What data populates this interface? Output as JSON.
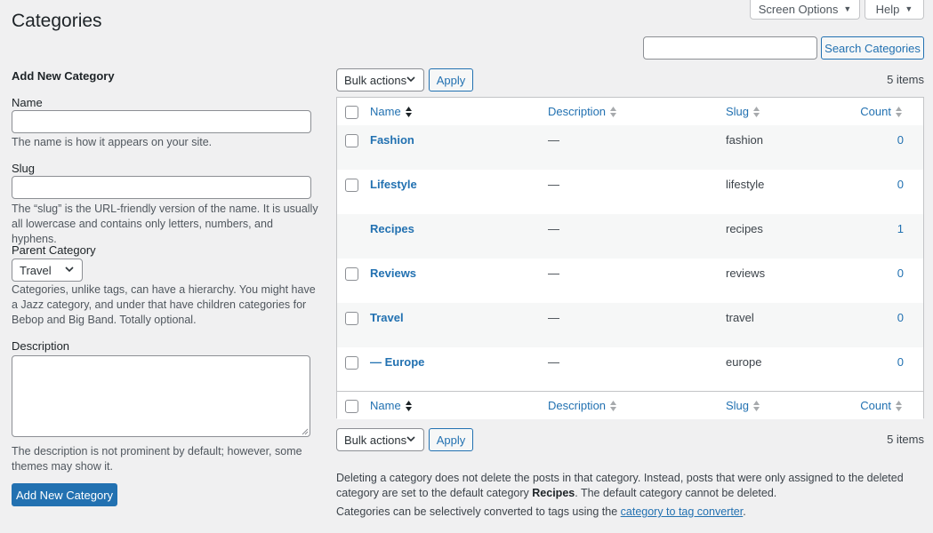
{
  "header": {
    "title": "Categories",
    "screen_options": "Screen Options",
    "help": "Help"
  },
  "search": {
    "value": "",
    "button": "Search Categories"
  },
  "form": {
    "title": "Add New Category",
    "name_label": "Name",
    "name_value": "",
    "name_help": "The name is how it appears on your site.",
    "slug_label": "Slug",
    "slug_value": "",
    "slug_help": "The “slug” is the URL-friendly version of the name. It is usually all lowercase and contains only letters, numbers, and hyphens.",
    "parent_label": "Parent Category",
    "parent_value": "Travel",
    "parent_help": "Categories, unlike tags, can have a hierarchy. You might have a Jazz category, and under that have children categories for Bebop and Big Band. Totally optional.",
    "description_label": "Description",
    "description_value": "",
    "description_help": "The description is not prominent by default; however, some themes may show it.",
    "submit": "Add New Category"
  },
  "table_nav": {
    "bulk_label": "Bulk actions",
    "apply": "Apply",
    "count": "5 items"
  },
  "table": {
    "columns": {
      "name": "Name",
      "description": "Description",
      "slug": "Slug",
      "count": "Count"
    },
    "rows": [
      {
        "name": "Fashion",
        "description": "—",
        "slug": "fashion",
        "count": "0",
        "checkbox": true
      },
      {
        "name": "Lifestyle",
        "description": "—",
        "slug": "lifestyle",
        "count": "0",
        "checkbox": true
      },
      {
        "name": "Recipes",
        "description": "—",
        "slug": "recipes",
        "count": "1",
        "checkbox": false
      },
      {
        "name": "Reviews",
        "description": "—",
        "slug": "reviews",
        "count": "0",
        "checkbox": true
      },
      {
        "name": "Travel",
        "description": "—",
        "slug": "travel",
        "count": "0",
        "checkbox": true
      },
      {
        "name": "— Europe",
        "description": "—",
        "slug": "europe",
        "count": "0",
        "checkbox": true
      }
    ]
  },
  "notes": {
    "delete_part1": "Deleting a category does not delete the posts in that category. Instead, posts that were only assigned to the deleted category are set to the default category ",
    "default_category": "Recipes",
    "delete_part2": ". The default category cannot be deleted.",
    "convert_part1": "Categories can be selectively converted to tags using the ",
    "convert_link": "category to tag converter",
    "convert_part2": "."
  },
  "colors": {
    "accent": "#2271b1",
    "background": "#f0f0f1",
    "text": "#3c434a"
  }
}
